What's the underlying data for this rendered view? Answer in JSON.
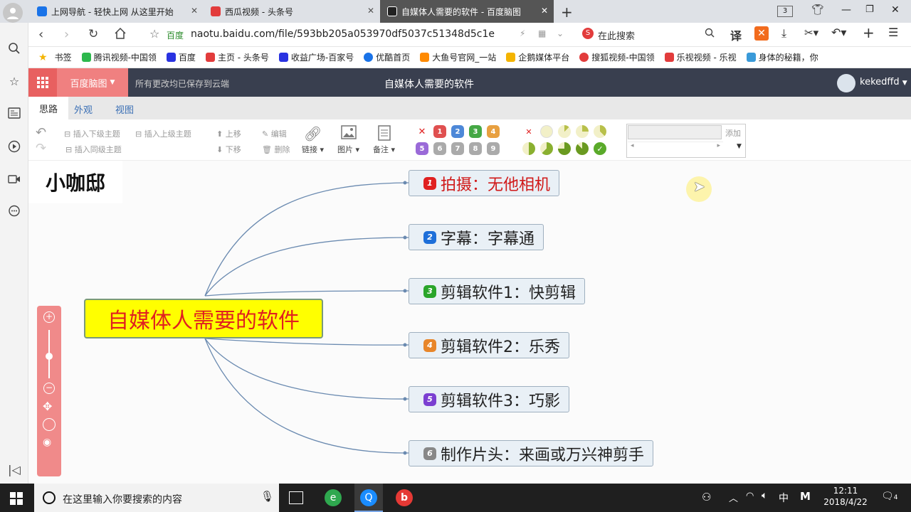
{
  "browser": {
    "tabs": [
      {
        "label": "上网导航 - 轻快上网 从这里开始",
        "color": "#1a73e8"
      },
      {
        "label": "西瓜视频 - 头条号",
        "color": "#e23c3c"
      },
      {
        "label": "自媒体人需要的软件 - 百度脑图",
        "color": "#333"
      }
    ],
    "new_tab": "+",
    "tab_count": "3",
    "site_badge": "百度",
    "url": "naotu.baidu.com/file/593bb205a053970df5037c51348d5c1e",
    "search_placeholder": "在此搜索",
    "translate_label": "译",
    "bookmarks": [
      {
        "label": "书签",
        "color": "#f4b400"
      },
      {
        "label": "腾讯视频-中国领",
        "color": "#2db84d"
      },
      {
        "label": "百度",
        "color": "#2932e1"
      },
      {
        "label": "主页 - 头条号",
        "color": "#e23c3c"
      },
      {
        "label": "收益广场-百家号",
        "color": "#2932e1"
      },
      {
        "label": "优酷首页",
        "color": "#1a73e8"
      },
      {
        "label": "大鱼号官网_一站",
        "color": "#ff8a00"
      },
      {
        "label": "企鹅媒体平台",
        "color": "#f4b400"
      },
      {
        "label": "搜狐视频-中国领",
        "color": "#e23c3c"
      },
      {
        "label": "乐视视频 - 乐视",
        "color": "#e23c3c"
      },
      {
        "label": "身体的秘籍，你",
        "color": "#3a9ad9"
      }
    ]
  },
  "naotu": {
    "app_name": "百度脑图",
    "save_status": "所有更改均已保存到云端",
    "doc_title": "自媒体人需要的软件",
    "user": "kekedffd",
    "menu_tabs": [
      "思路",
      "外观",
      "视图"
    ],
    "toolbar": {
      "insert_child": "插入下级主题",
      "insert_parent": "插入上级主题",
      "insert_sibling": "插入同级主题",
      "move_up": "上移",
      "move_down": "下移",
      "edit": "编辑",
      "delete": "删除",
      "link": "链接",
      "image": "图片",
      "note": "备注",
      "tag_add": "添加",
      "priorities_row1": [
        "1",
        "2",
        "3",
        "4"
      ],
      "priorities_row2": [
        "5",
        "6",
        "7",
        "8",
        "9"
      ]
    },
    "watermark": "小咖邸",
    "root": "自媒体人需要的软件",
    "children": [
      {
        "num": "1",
        "label": "拍摄：无他相机",
        "color": "#e02020",
        "text_color": "#d01818"
      },
      {
        "num": "2",
        "label": "字幕：字幕通",
        "color": "#1e6fd9",
        "text_color": "#222"
      },
      {
        "num": "3",
        "label": "剪辑软件1：快剪辑",
        "color": "#2aa52a",
        "text_color": "#222"
      },
      {
        "num": "4",
        "label": "剪辑软件2：乐秀",
        "color": "#e8862a",
        "text_color": "#222"
      },
      {
        "num": "5",
        "label": "剪辑软件3：巧影",
        "color": "#7b3fd1",
        "text_color": "#222"
      },
      {
        "num": "6",
        "label": "制作片头：来画或万兴神剪手",
        "color": "#888888",
        "text_color": "#222"
      }
    ]
  },
  "taskbar": {
    "search_placeholder": "在这里输入你要搜索的内容",
    "ime": "中",
    "time": "12:11",
    "date": "2018/4/22",
    "notify_count": "4"
  }
}
